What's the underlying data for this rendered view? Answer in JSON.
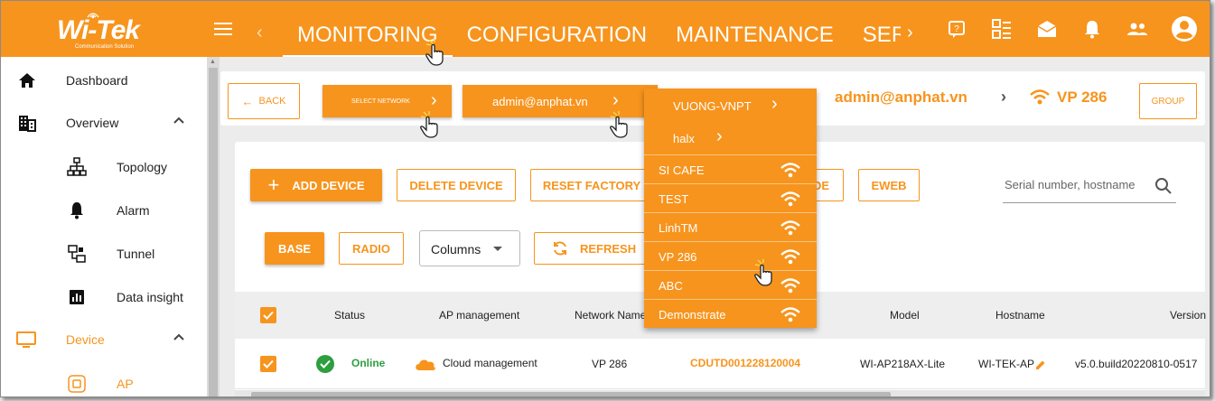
{
  "brand": {
    "logo": "Wi-Tek",
    "tagline": "Communication Solution"
  },
  "nav": {
    "tabs": [
      {
        "label": "MONITORING",
        "active": true
      },
      {
        "label": "CONFIGURATION",
        "active": false
      },
      {
        "label": "MAINTENANCE",
        "active": false
      },
      {
        "label": "SERVIC",
        "active": false
      }
    ]
  },
  "top_icons": [
    "help-icon",
    "dashboard-list-icon",
    "message-icon",
    "bell-icon",
    "users-icon",
    "account-icon"
  ],
  "sidebar": {
    "items": [
      {
        "label": "Dashboard",
        "icon": "home-icon"
      },
      {
        "label": "Overview",
        "icon": "building-icon"
      },
      {
        "label": "Topology",
        "icon": "topology-icon"
      },
      {
        "label": "Alarm",
        "icon": "bell-icon"
      },
      {
        "label": "Tunnel",
        "icon": "tunnel-icon"
      },
      {
        "label": "Data insight",
        "icon": "chart-icon"
      },
      {
        "label": "Device",
        "icon": "monitor-icon"
      },
      {
        "label": "AP",
        "icon": "ap-icon"
      }
    ]
  },
  "breadcrumb": {
    "back_label": "BACK",
    "select_network": "SELECT NETWORK",
    "account_chip": "admin@anphat.vn",
    "account_text": "admin@anphat.vn",
    "network_text": "VP 286",
    "group_label": "GROUP"
  },
  "toolbar": {
    "add_device": "ADD DEVICE",
    "delete_device": "DELETE DEVICE",
    "reset_factory": "RESET FACTORY",
    "partial_button": "DE",
    "eweb": "EWEB",
    "search_placeholder": "Serial number, hostname",
    "base_tab": "BASE",
    "radio_tab": "RADIO",
    "columns_label": "Columns",
    "refresh": "REFRESH"
  },
  "table": {
    "headers": [
      "Status",
      "AP management",
      "Network Name",
      "Model",
      "Hostname",
      "Version"
    ],
    "rows": [
      {
        "status": "Online",
        "ap_management": "Cloud management",
        "network_name": "VP 286",
        "serial": "CDUTD001228120004",
        "model": "WI-AP218AX-Lite",
        "hostname": "WI-TEK-AP",
        "version": "v5.0.build20220810-0517"
      }
    ]
  },
  "dropdown": {
    "groups": [
      "VUONG-VNPT",
      "halx"
    ],
    "networks": [
      "SI CAFE",
      "TEST",
      "LinhTM",
      "VP 286",
      "ABC",
      "Demonstrate"
    ]
  },
  "colors": {
    "accent": "#f7941d",
    "online": "#2e9e3f"
  }
}
